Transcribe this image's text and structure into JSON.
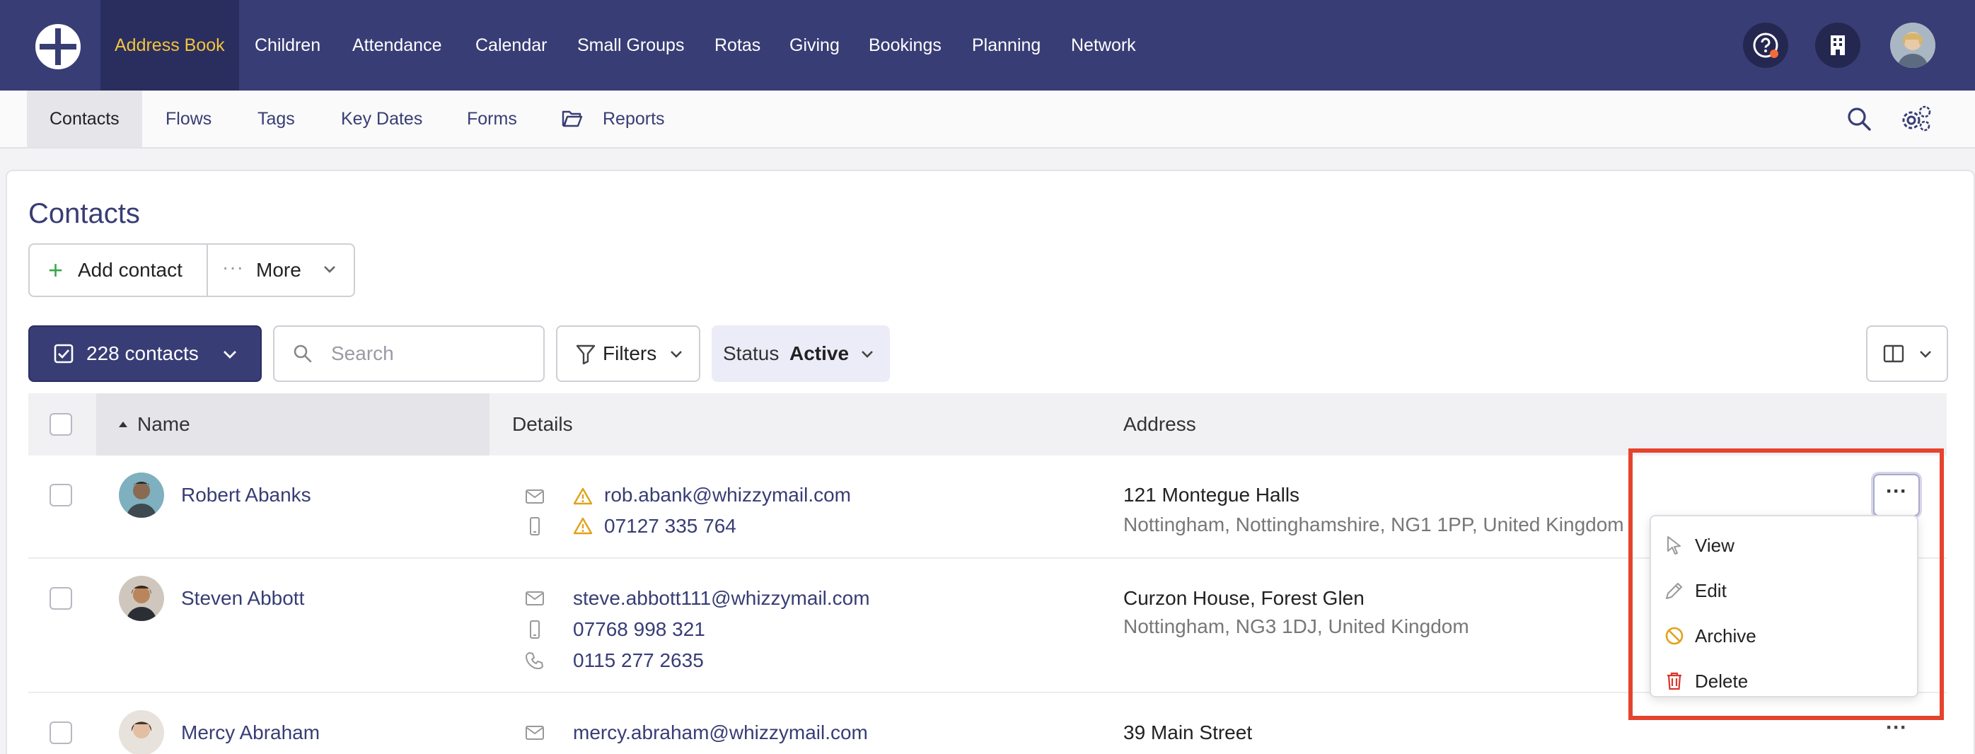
{
  "topnav": {
    "items": [
      "Address Book",
      "Children",
      "Attendance",
      "Calendar",
      "Small Groups",
      "Rotas",
      "Giving",
      "Bookings",
      "Planning",
      "Network"
    ],
    "active": "Address Book"
  },
  "subnav": {
    "items": [
      "Contacts",
      "Flows",
      "Tags",
      "Key Dates",
      "Forms",
      "Reports"
    ],
    "active": "Contacts"
  },
  "page": {
    "title": "Contacts",
    "add_contact": "Add contact",
    "more": "More",
    "contacts_count": "228 contacts",
    "search_placeholder": "Search",
    "filters": "Filters",
    "status_label": "Status",
    "status_value": "Active"
  },
  "table": {
    "headers": {
      "name": "Name",
      "details": "Details",
      "address": "Address"
    },
    "rows": [
      {
        "name": "Robert Abanks",
        "email": "rob.abank@whizzymail.com",
        "mobile": "07127 335 764",
        "address_line1": "121 Montegue Halls",
        "address_line2": "Nottingham, Nottinghamshire, NG1 1PP, United Kingdom"
      },
      {
        "name": "Steven Abbott",
        "email": "steve.abbott111@whizzymail.com",
        "mobile": "07768 998 321",
        "phone": "0115 277 2635",
        "address_line1": "Curzon House, Forest Glen",
        "address_line2": "Nottingham, NG3 1DJ, United Kingdom"
      },
      {
        "name": "Mercy Abraham",
        "email": "mercy.abraham@whizzymail.com",
        "address_line1": "39 Main Street"
      }
    ]
  },
  "row_menu": {
    "items": [
      "View",
      "Edit",
      "Archive",
      "Delete"
    ]
  },
  "colors": {
    "nav_bg": "#383d75",
    "accent_gold": "#f3c33c",
    "link": "#383d75",
    "warning": "#e0a21a",
    "danger": "#d9342b",
    "highlight": "#e5432d"
  }
}
